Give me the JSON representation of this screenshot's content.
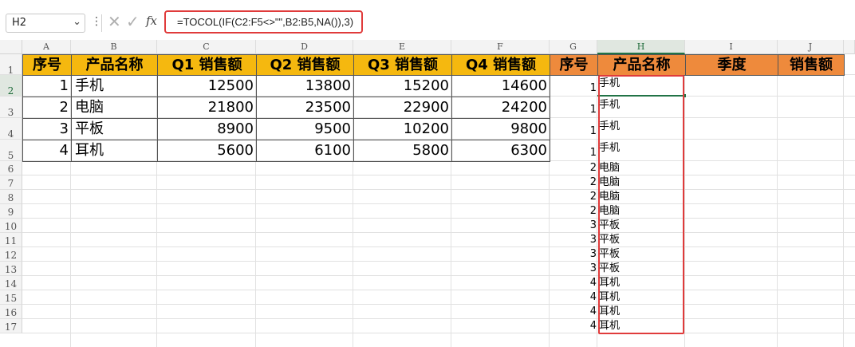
{
  "formula_bar": {
    "name_box": "H2",
    "dropdown_icon": "chevron-down-icon",
    "more_icon": "vertical-dots-icon",
    "cancel_glyph": "✕",
    "enter_glyph": "✓",
    "fx_label": "fx",
    "formula": "=TOCOL(IF(C2:F5<>\"\",B2:B5,NA()),3)"
  },
  "columns": [
    "A",
    "B",
    "C",
    "D",
    "E",
    "F",
    "G",
    "H",
    "I",
    "J"
  ],
  "selected_column": "H",
  "rows": [
    "1",
    "2",
    "3",
    "4",
    "5",
    "6",
    "7",
    "8",
    "9",
    "10",
    "11",
    "12",
    "13",
    "14",
    "15",
    "16",
    "17"
  ],
  "selected_row": "2",
  "source_table": {
    "headers": [
      "序号",
      "产品名称",
      "Q1 销售额",
      "Q2 销售额",
      "Q3 销售额",
      "Q4 销售额"
    ],
    "rows": [
      {
        "id": "1",
        "name": "手机",
        "q1": "12500",
        "q2": "13800",
        "q3": "15200",
        "q4": "14600"
      },
      {
        "id": "2",
        "name": "电脑",
        "q1": "21800",
        "q2": "23500",
        "q3": "22900",
        "q4": "24200"
      },
      {
        "id": "3",
        "name": "平板",
        "q1": "8900",
        "q2": "9500",
        "q3": "10200",
        "q4": "9800"
      },
      {
        "id": "4",
        "name": "耳机",
        "q1": "5600",
        "q2": "6100",
        "q3": "5800",
        "q4": "6300"
      }
    ]
  },
  "result_table": {
    "headers": [
      "序号",
      "产品名称",
      "季度",
      "销售额"
    ],
    "rows": [
      {
        "id": "1",
        "name": "手机"
      },
      {
        "id": "1",
        "name": "手机"
      },
      {
        "id": "1",
        "name": "手机"
      },
      {
        "id": "1",
        "name": "手机"
      },
      {
        "id": "2",
        "name": "电脑"
      },
      {
        "id": "2",
        "name": "电脑"
      },
      {
        "id": "2",
        "name": "电脑"
      },
      {
        "id": "2",
        "name": "电脑"
      },
      {
        "id": "3",
        "name": "平板"
      },
      {
        "id": "3",
        "name": "平板"
      },
      {
        "id": "3",
        "name": "平板"
      },
      {
        "id": "3",
        "name": "平板"
      },
      {
        "id": "4",
        "name": "耳机"
      },
      {
        "id": "4",
        "name": "耳机"
      },
      {
        "id": "4",
        "name": "耳机"
      },
      {
        "id": "4",
        "name": "耳机"
      }
    ]
  },
  "colors": {
    "header_yellow": "#f5b80f",
    "header_orange": "#ee8a3c",
    "highlight_red": "#e03b3b",
    "selection_green": "#217346"
  }
}
